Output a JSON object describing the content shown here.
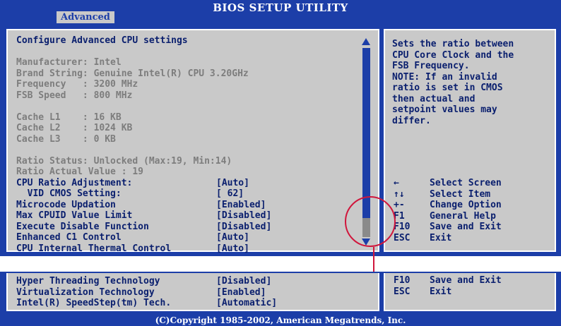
{
  "header": {
    "title": "BIOS SETUP UTILITY",
    "active_tab": "Advanced"
  },
  "main": {
    "heading": "Configure Advanced CPU settings",
    "info_lines": [
      "Manufacturer: Intel",
      "Brand String: Genuine Intel(R) CPU 3.20GHz",
      "Frequency   : 3200 MHz",
      "FSB Speed   : 800 MHz",
      "",
      "Cache L1    : 16 KB",
      "Cache L2    : 1024 KB",
      "Cache L3    : 0 KB",
      "",
      "Ratio Status: Unlocked (Max:19, Min:14)",
      "Ratio Actual Value : 19"
    ],
    "settings": [
      {
        "label": "CPU Ratio Adjustment:",
        "value": "[Auto]"
      },
      {
        "label": "  VID CMOS Setting:",
        "value": "[ 62]"
      },
      {
        "label": "Microcode Updation",
        "value": "[Enabled]"
      },
      {
        "label": "Max CPUID Value Limit",
        "value": "[Disabled]"
      },
      {
        "label": "Execute Disable Function",
        "value": "[Disabled]"
      },
      {
        "label": "Enhanced C1 Control",
        "value": "[Auto]"
      },
      {
        "label": "CPU Internal Thermal Control",
        "value": "[Auto]"
      }
    ],
    "scroll_position": 0.9
  },
  "help": {
    "lines": [
      "Sets the ratio between",
      "CPU Core Clock and the",
      "FSB Frequency.",
      "NOTE: If an invalid",
      "ratio is set in CMOS",
      "then actual and",
      "setpoint values may",
      "differ."
    ],
    "keys": [
      {
        "key": "←",
        "action": "Select Screen"
      },
      {
        "key": "↑↓",
        "action": "Select Item"
      },
      {
        "key": "+-",
        "action": "Change Option"
      },
      {
        "key": "F1",
        "action": "General Help"
      },
      {
        "key": "F10",
        "action": "Save and Exit"
      },
      {
        "key": "ESC",
        "action": "Exit"
      }
    ]
  },
  "continued": {
    "settings": [
      {
        "label": "Hyper Threading Technology",
        "value": "[Disabled]"
      },
      {
        "label": "Virtualization Technology",
        "value": "[Enabled]"
      },
      {
        "label": "Intel(R) SpeedStep(tm) Tech.",
        "value": "[Automatic]"
      }
    ],
    "keys": [
      {
        "key": "F10",
        "action": "Save and Exit"
      },
      {
        "key": "ESC",
        "action": "Exit"
      }
    ]
  },
  "footer": {
    "copyright": "(C)Copyright 1985-2002, American Megatrends, Inc."
  },
  "colors": {
    "frame_blue": "#1c3ea8",
    "panel_grey": "#c9c9c9",
    "text_blue": "#0a1f6e",
    "disabled_grey": "#7d7d7d",
    "callout_red": "#d0163c"
  }
}
